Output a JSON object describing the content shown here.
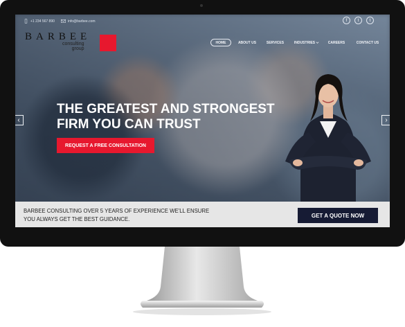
{
  "contact": {
    "phone": "+1 234 567 890",
    "email": "info@barbee.com"
  },
  "social": [
    {
      "icon": "facebook-icon",
      "glyph": "f"
    },
    {
      "icon": "twitter-icon",
      "glyph": "t"
    },
    {
      "icon": "twitter-icon",
      "glyph": "t"
    }
  ],
  "logo": {
    "word": "BARBEE",
    "sub_line1": "consulting",
    "sub_line2": "group",
    "accent": "#e7182e"
  },
  "nav": [
    "HOME",
    "ABOUT US",
    "SERVICES",
    "INDUSTRIES",
    "CAREERS",
    "CONTACT US"
  ],
  "hero": {
    "headline_line1": "THE GREATEST AND STRONGEST",
    "headline_line2": "FIRM YOU CAN TRUST",
    "cta_label": "REQUEST A FREE CONSULTATION"
  },
  "slider": {
    "prev_glyph": "‹",
    "next_glyph": "›"
  },
  "banner": {
    "line1": "BARBEE CONSULTING OVER 5 YEARS OF EXPERIENCE WE'LL ENSURE",
    "line2": "YOU ALWAYS GET THE BEST GUIDANCE.",
    "button": "GET A QUOTE NOW",
    "button_color": "#161b34"
  }
}
